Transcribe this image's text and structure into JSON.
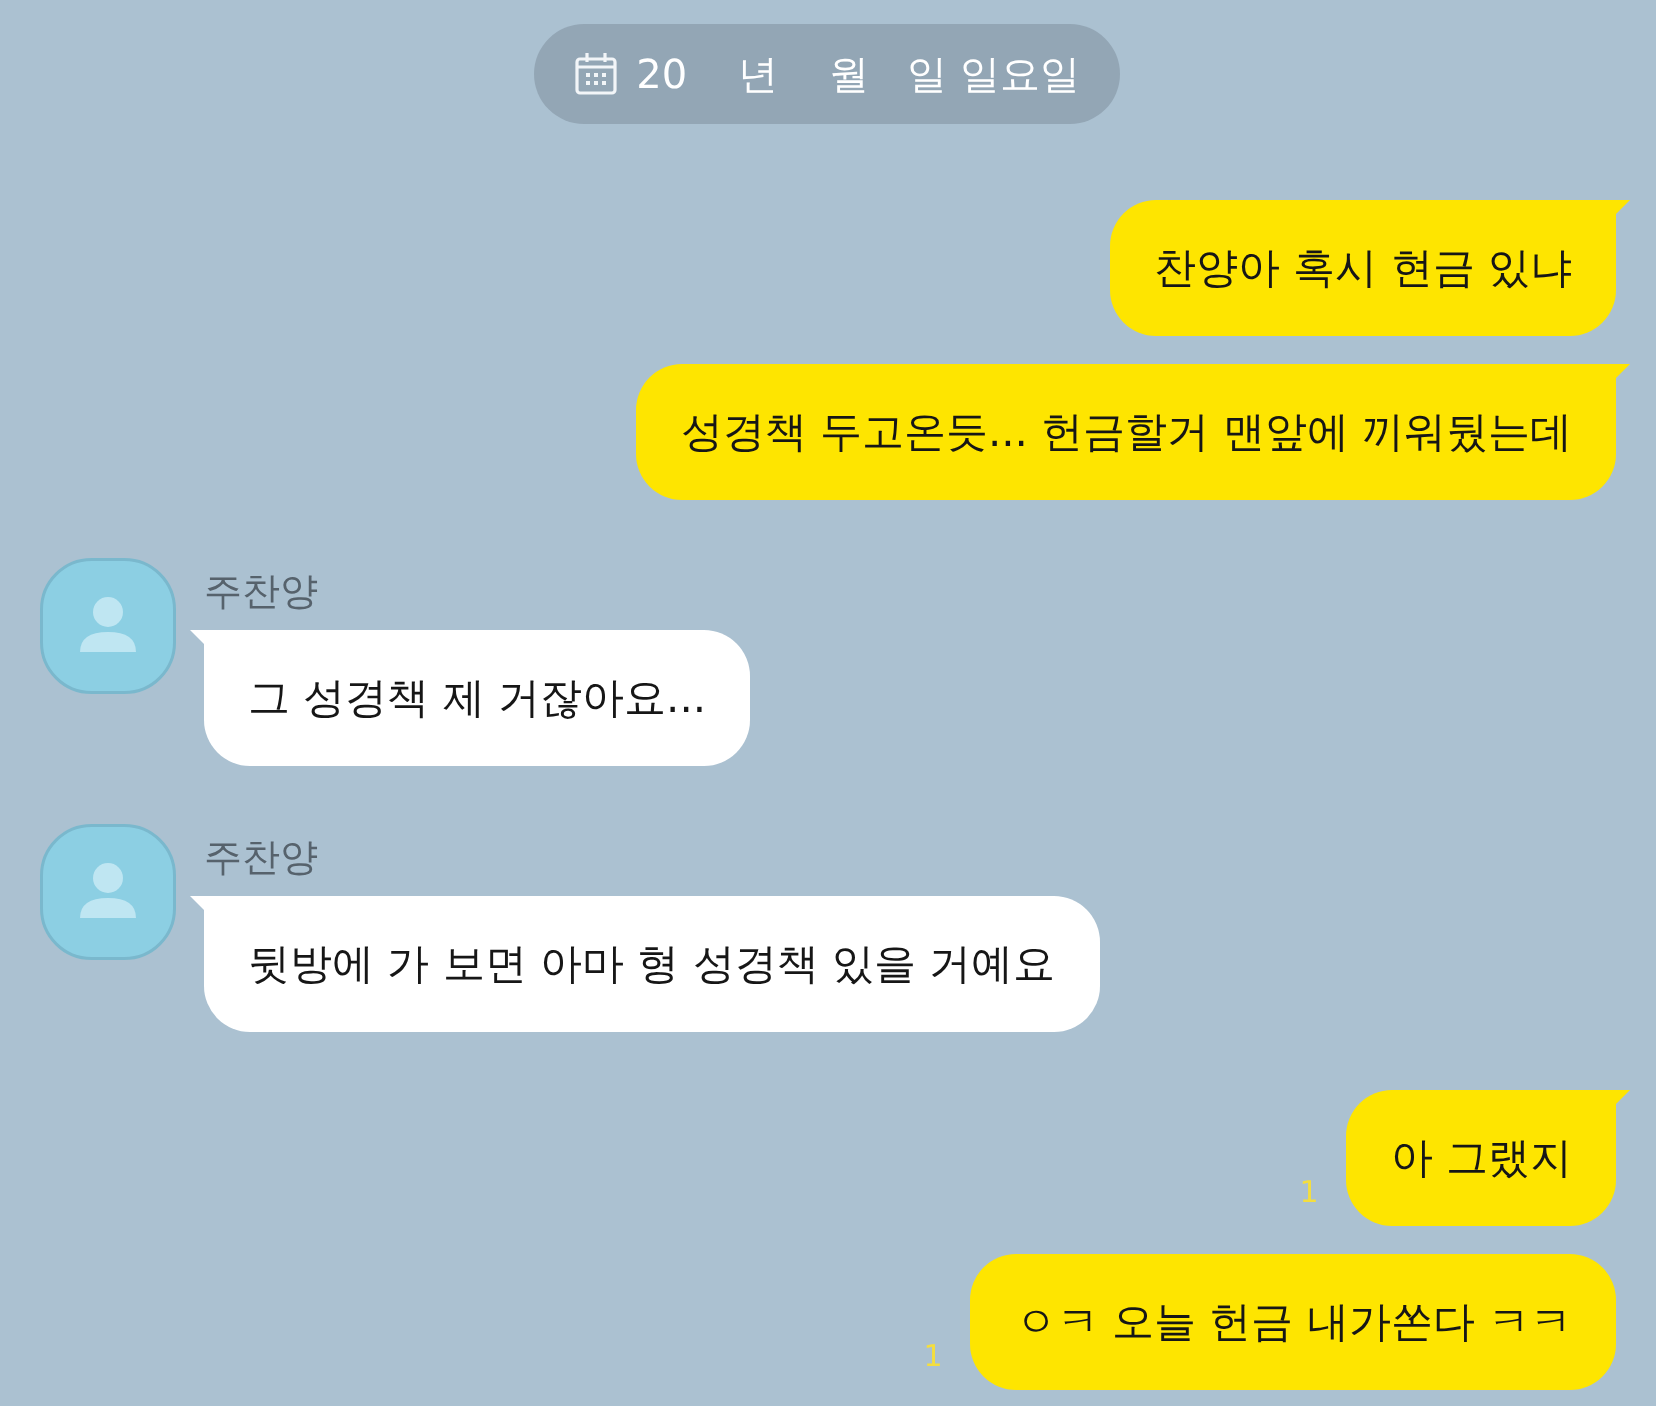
{
  "date_divider": {
    "text": "20    년    월   일 일요일"
  },
  "messages": [
    {
      "kind": "sent",
      "text": "찬양아 혹시 현금 있냐",
      "tail": true
    },
    {
      "kind": "sent",
      "text": "성경책 두고온듯... 헌금할거 맨앞에 끼워뒀는데",
      "tail": true
    },
    {
      "kind": "received",
      "sender": "주찬양",
      "text": "그 성경책 제 거잖아요...",
      "tail": true
    },
    {
      "kind": "received",
      "sender": "주찬양",
      "text": "뒷방에 가 보면 아마 형 성경책 있을 거예요",
      "tail": true
    },
    {
      "kind": "sent",
      "text": "아 그랬지",
      "tail": true,
      "unread": "1"
    },
    {
      "kind": "sent",
      "text": "ㅇㅋ 오늘 헌금 내가쏜다 ㅋㅋ",
      "tail": false,
      "unread": "1"
    }
  ]
}
